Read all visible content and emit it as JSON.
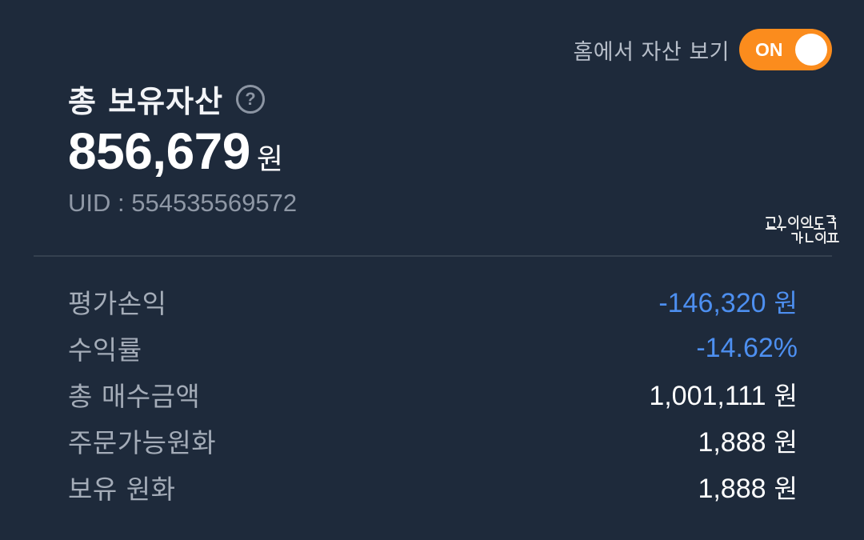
{
  "home_toggle": {
    "label": "홈에서 자산 보기",
    "state": "ON",
    "accent_color": "#fb8c1d"
  },
  "summary": {
    "title": "총 보유자산",
    "help_icon": "question-circle-icon",
    "total_amount": "856,679",
    "total_unit": "원",
    "uid_text": "UID : 554535569572"
  },
  "watermark": {
    "text": "곰손이의 노력 라이프"
  },
  "details": [
    {
      "label": "평가손익",
      "value": "-146,320",
      "unit": "원",
      "color": "#4d8ff0"
    },
    {
      "label": "수익률",
      "value": "-14.62%",
      "unit": "",
      "color": "#4d8ff0"
    },
    {
      "label": "총 매수금액",
      "value": "1,001,111",
      "unit": "원",
      "color": "#ffffff"
    },
    {
      "label": "주문가능원화",
      "value": "1,888",
      "unit": "원",
      "color": "#ffffff"
    },
    {
      "label": "보유 원화",
      "value": "1,888",
      "unit": "원",
      "color": "#ffffff"
    }
  ]
}
